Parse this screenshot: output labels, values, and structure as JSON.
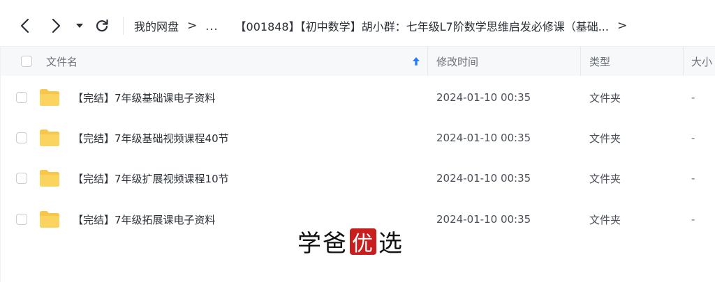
{
  "toolbar": {
    "back_icon": "chevron-left-icon",
    "forward_icon": "chevron-right-icon",
    "dropdown_icon": "caret-down-icon",
    "refresh_icon": "refresh-icon"
  },
  "breadcrumb": {
    "root": "我的网盘",
    "separator": ">",
    "ellipsis": "...",
    "current": "【001848】【初中数学】胡小群：七年级L7阶数学思维启发必修课（基础...",
    "trailing_separator": ">"
  },
  "columns": {
    "name": "文件名",
    "modified": "修改时间",
    "type": "类型",
    "size": "大小",
    "sort_icon": "arrow-up-icon",
    "sort_color": "#2b7cf6"
  },
  "files": [
    {
      "name": "【完结】7年级基础课电子资料",
      "modified": "2024-01-10 00:35",
      "type": "文件夹",
      "size": "-"
    },
    {
      "name": "【完结】7年级基础视频课程40节",
      "modified": "2024-01-10 00:35",
      "type": "文件夹",
      "size": "-"
    },
    {
      "name": "【完结】7年级扩展视频课程10节",
      "modified": "2024-01-10 00:35",
      "type": "文件夹",
      "size": "-"
    },
    {
      "name": "【完结】7年级拓展课电子资料",
      "modified": "2024-01-10 00:35",
      "type": "文件夹",
      "size": "-"
    }
  ],
  "folder_color": "#f8c64a",
  "watermark": {
    "part1": "学爸",
    "badge": "优",
    "part2": "选",
    "badge_color": "#c81e1e"
  }
}
